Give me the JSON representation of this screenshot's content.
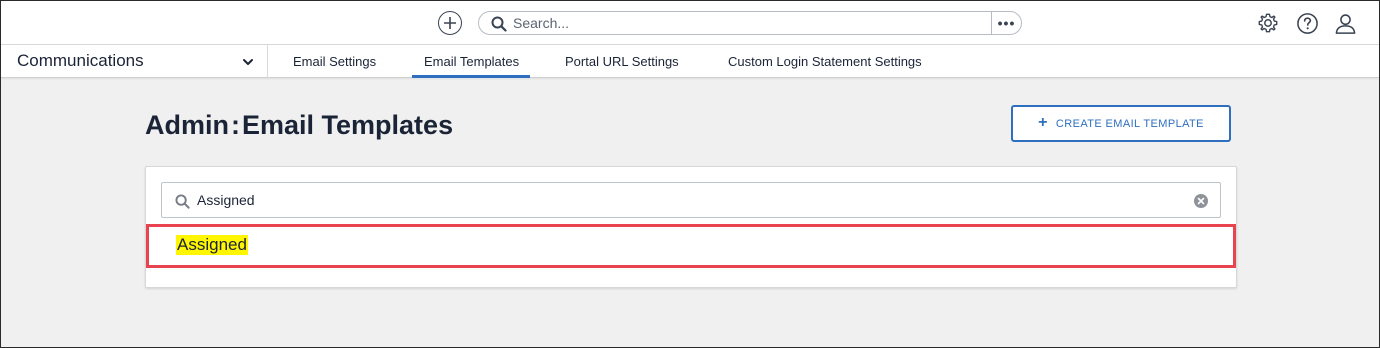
{
  "topbar": {
    "search_placeholder": "Search...",
    "more_label": "•••",
    "icons": [
      "add-circle-icon",
      "search-icon",
      "settings-gear-icon",
      "help-icon",
      "user-profile-icon"
    ]
  },
  "subnav": {
    "app_name": "Communications",
    "tabs": [
      {
        "label": "Email Settings",
        "active": false
      },
      {
        "label": "Email Templates",
        "active": true
      },
      {
        "label": "Portal URL Settings",
        "active": false
      },
      {
        "label": "Custom Login Statement Settings",
        "active": false
      }
    ]
  },
  "header": {
    "title_prefix": "Admin",
    "title_sep": ":",
    "title_main": "Email Templates",
    "create_button_label": "CREATE EMAIL TEMPLATE"
  },
  "card": {
    "search_value": "Assigned",
    "results": [
      {
        "label": "Assigned"
      }
    ]
  },
  "colors": {
    "accent": "#2f6fbf",
    "highlight": "#fff600",
    "callout_border": "#e8434e",
    "background": "#f0f0f0"
  }
}
